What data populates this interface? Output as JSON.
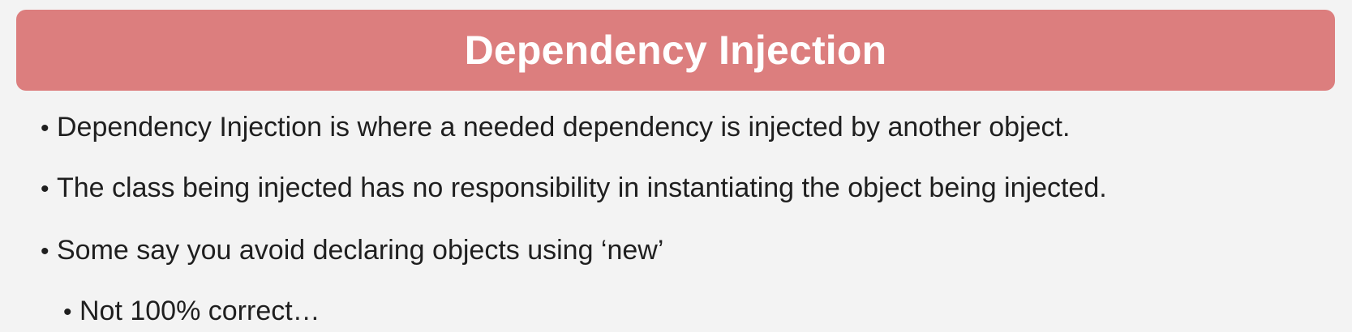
{
  "title": "Dependency Injection",
  "bullets": [
    {
      "text": "Dependency Injection is where a needed dependency is injected by another object."
    },
    {
      "text": "The class being injected has no responsibility in instantiating the object being injected."
    },
    {
      "text": "Some say you avoid declaring objects using ‘new’"
    },
    {
      "text": "Not 100% correct…"
    }
  ],
  "bullet_glyph": "•",
  "colors": {
    "title_background": "#dc7e7e",
    "title_text": "#ffffff",
    "page_background": "#f3f3f3",
    "body_text": "#1f1f1f"
  }
}
